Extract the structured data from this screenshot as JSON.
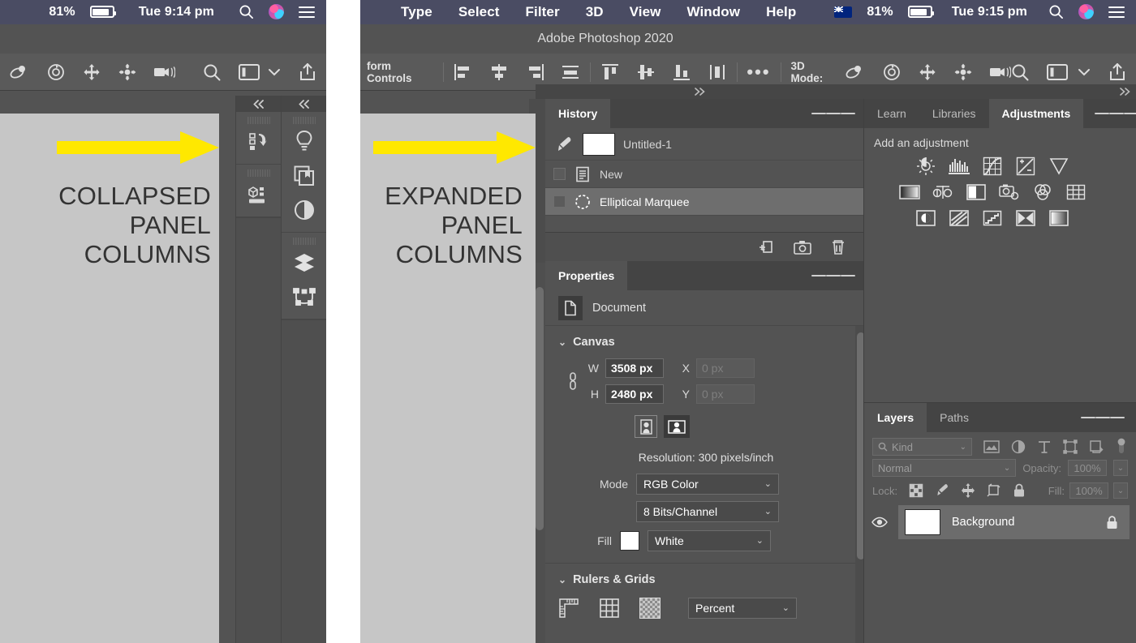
{
  "left_capture": {
    "menubar": {
      "battery_percent": "81%",
      "clock": "Tue 9:14 pm"
    },
    "options_bar": {
      "threed_mode_label": ""
    },
    "annotation": {
      "caption": "COLLAPSED\nPANEL\nCOLUMNS",
      "arrow_color": "#ffe800",
      "bg_color": "#c6c6c6",
      "text_color": "#333333"
    },
    "collapsed_columns": [
      {
        "name": "column-1",
        "collapse_label": "«",
        "groups": [
          {
            "icons": [
              "history-icon"
            ]
          },
          {
            "icons": [
              "properties-icon"
            ]
          }
        ]
      },
      {
        "name": "column-2",
        "collapse_label": "«",
        "groups": [
          {
            "icons": [
              "learn-bulb-icon",
              "libraries-icon",
              "adjustments-icon"
            ]
          },
          {
            "icons": [
              "layers-icon",
              "paths-icon"
            ]
          }
        ]
      }
    ]
  },
  "right_capture": {
    "menubar": {
      "items": [
        "Type",
        "Select",
        "Filter",
        "3D",
        "View",
        "Window",
        "Help"
      ],
      "flag": "au-flag-icon",
      "battery_percent": "81%",
      "clock": "Tue 9:15 pm"
    },
    "app_title": "Adobe Photoshop 2020",
    "options_bar": {
      "transform_controls_label": "form Controls",
      "more_label": "•••",
      "threed_mode_label": "3D Mode:"
    },
    "annotation": {
      "caption": "EXPANDED\nPANEL\nCOLUMNS",
      "arrow_color": "#ffe800",
      "bg_color": "#c6c6c6",
      "text_color": "#333333"
    },
    "history_panel": {
      "tab": "History",
      "snapshot": {
        "name": "Untitled-1",
        "icon": "snapshot-brush-icon"
      },
      "states": [
        {
          "label": "New",
          "icon": "new-document-icon",
          "selected": false
        },
        {
          "label": "Elliptical Marquee",
          "icon": "elliptical-marquee-icon",
          "selected": true
        }
      ],
      "footer_buttons": [
        "create-document-from-state-icon",
        "create-snapshot-icon",
        "delete-icon"
      ]
    },
    "properties_panel": {
      "tab": "Properties",
      "header": {
        "label": "Document",
        "icon": "document-icon"
      },
      "canvas": {
        "title": "Canvas",
        "link_icon": "link-icon",
        "w_label": "W",
        "w_value": "3508 px",
        "h_label": "H",
        "h_value": "2480 px",
        "x_label": "X",
        "x_placeholder": "0 px",
        "y_label": "Y",
        "y_placeholder": "0 px",
        "orientation": [
          "portrait-icon",
          "landscape-icon"
        ],
        "orientation_selected": "landscape-icon",
        "resolution": "Resolution: 300 pixels/inch",
        "mode_label": "Mode",
        "mode_value": "RGB Color",
        "depth_value": "8 Bits/Channel",
        "fill_label": "Fill",
        "fill_swatch": "#ffffff",
        "fill_value": "White"
      },
      "rulers_grids": {
        "title": "Rulers & Grids",
        "icons": [
          "rulers-icon",
          "grid-icon",
          "transparency-grid-icon"
        ],
        "units_value": "Percent"
      }
    },
    "adjustments_panel": {
      "tabs": [
        "Learn",
        "Libraries",
        "Adjustments"
      ],
      "active_tab": "Adjustments",
      "heading": "Add an adjustment",
      "rows": [
        [
          "brightness-contrast-icon",
          "levels-icon",
          "curves-icon",
          "exposure-icon",
          "vibrance-icon"
        ],
        [
          "hue-saturation-icon",
          "color-balance-icon",
          "black-white-icon",
          "photo-filter-icon",
          "channel-mixer-icon",
          "color-lookup-icon"
        ],
        [
          "invert-icon",
          "posterize-icon",
          "threshold-icon",
          "selective-color-icon",
          "gradient-map-icon"
        ]
      ]
    },
    "layers_panel": {
      "tabs": [
        "Layers",
        "Paths"
      ],
      "active_tab": "Layers",
      "filter": {
        "kind_label": "Kind",
        "search_icon": "search-icon",
        "filter_icons": [
          "filter-pixel-icon",
          "filter-adjustment-icon",
          "filter-type-icon",
          "filter-shape-icon",
          "filter-smartobject-icon"
        ],
        "toggle_icon": "filter-toggle-icon"
      },
      "blend_mode": "Normal",
      "opacity_label": "Opacity:",
      "opacity_value": "100%",
      "lock_label": "Lock:",
      "lock_icons": [
        "lock-transparent-pixels-icon",
        "lock-image-pixels-icon",
        "lock-position-icon",
        "lock-artboard-icon",
        "lock-all-icon"
      ],
      "fill_label": "Fill:",
      "fill_value": "100%",
      "layers": [
        {
          "name": "Background",
          "visible": true,
          "locked": true,
          "thumb_color": "#ffffff"
        }
      ]
    }
  }
}
